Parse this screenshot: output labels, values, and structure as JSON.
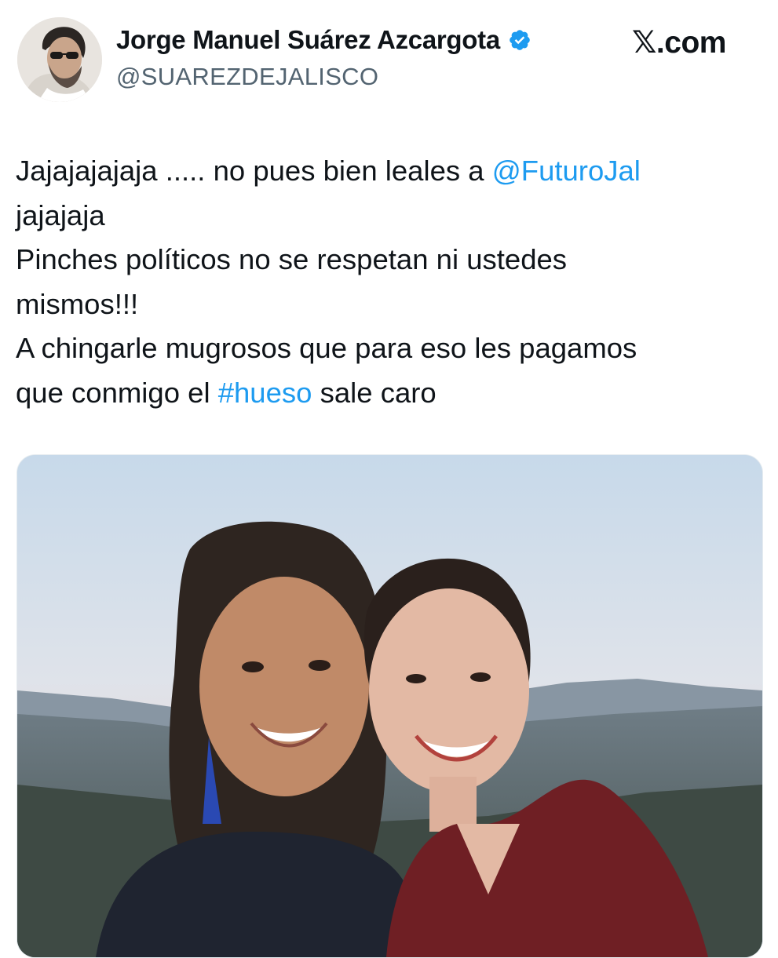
{
  "author": {
    "display_name": "Jorge Manuel Suárez Azcargota",
    "handle": "@SUAREZDEJALISCO",
    "verified": true,
    "avatar_icon": "profile-photo"
  },
  "source": {
    "domain_glyph": "𝕏",
    "domain_suffix": ".com"
  },
  "tweet": {
    "line1_text": "Jajajajajaja ..... no pues bien leales a ",
    "line1_mention": "@FuturoJal",
    "line2": "jajajaja",
    "line3": "Pinches políticos no se respetan ni ustedes",
    "line4": "mismos!!!",
    "line5": "A chingarle mugrosos que para eso les pagamos",
    "line6_text": "que conmigo el ",
    "line6_hashtag": "#hueso",
    "line6_tail": " sale caro"
  },
  "colors": {
    "link": "#1d9bf0",
    "text": "#0f1419",
    "muted": "#536471",
    "verified_badge": "#1d9bf0"
  },
  "media": {
    "icon": "photo-two-women-smiling-mountain-landscape"
  }
}
